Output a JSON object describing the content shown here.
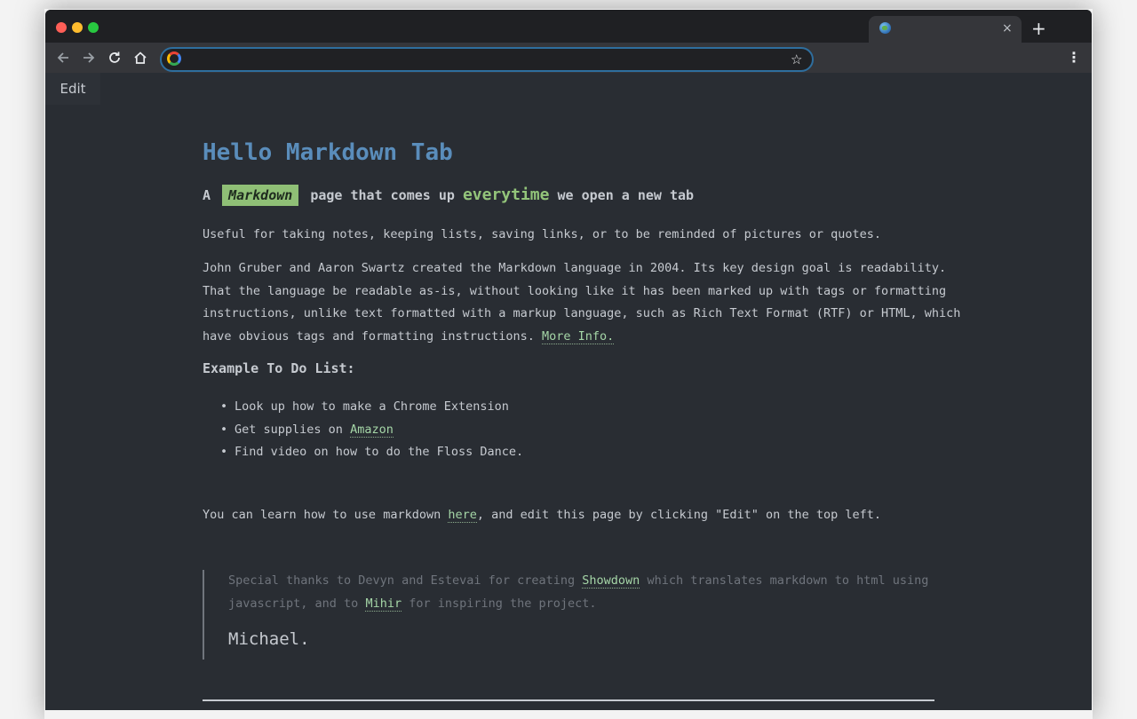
{
  "browser": {
    "tab_title": "",
    "new_tab_label": "+",
    "tab_close_label": "×",
    "address_value": "",
    "address_placeholder": "",
    "icons": [
      "back-icon",
      "forward-icon",
      "reload-icon",
      "home-icon",
      "google-icon",
      "star-icon",
      "menu-icon",
      "globe-icon"
    ]
  },
  "edit_label": "Edit",
  "article": {
    "title": "Hello Markdown Tab",
    "subtitle_a": "A",
    "subtitle_badge": "Markdown",
    "subtitle_b": "page that comes up",
    "subtitle_em": "everytime",
    "subtitle_c": "we open a new tab",
    "intro": "Useful for taking notes, keeping lists, saving links, or to be reminded of pictures or quotes.",
    "para_lines": [
      "John Gruber and Aaron Swartz created the Markdown language in 2004. Its key design goal is readability.",
      "That the language be readable as-is, without looking like it has been marked up with tags or formatting",
      "instructions, unlike text formatted with a markup language, such as Rich Text Format (RTF) or HTML, which",
      "have obvious tags and formatting instructions."
    ],
    "more_info": "More Info.",
    "todo_heading": "Example To Do List:",
    "todo_1": "Look up how to make a Chrome Extension",
    "todo_2_a": "Get supplies on",
    "todo_2_link": "Amazon",
    "todo_3": "Find video on how to do the Floss Dance.",
    "learn_a": "You can learn how to use markdown",
    "learn_link": "here",
    "learn_b": ", and edit this page by clicking \"Edit\" on the top left.",
    "quote_a": "Special thanks to Devyn and Estevai for creating",
    "quote_link1": "Showdown",
    "quote_b": "which translates markdown to html using",
    "quote_c": "javascript, and to",
    "quote_link2": "Mihir",
    "quote_d": "for inspiring the project.",
    "signature": "Michael."
  },
  "colors": {
    "background": "#292d33",
    "title": "#5a8dbb",
    "accent_green": "#93c57a",
    "link": "#a5d6a7",
    "text": "#c6cad0"
  }
}
